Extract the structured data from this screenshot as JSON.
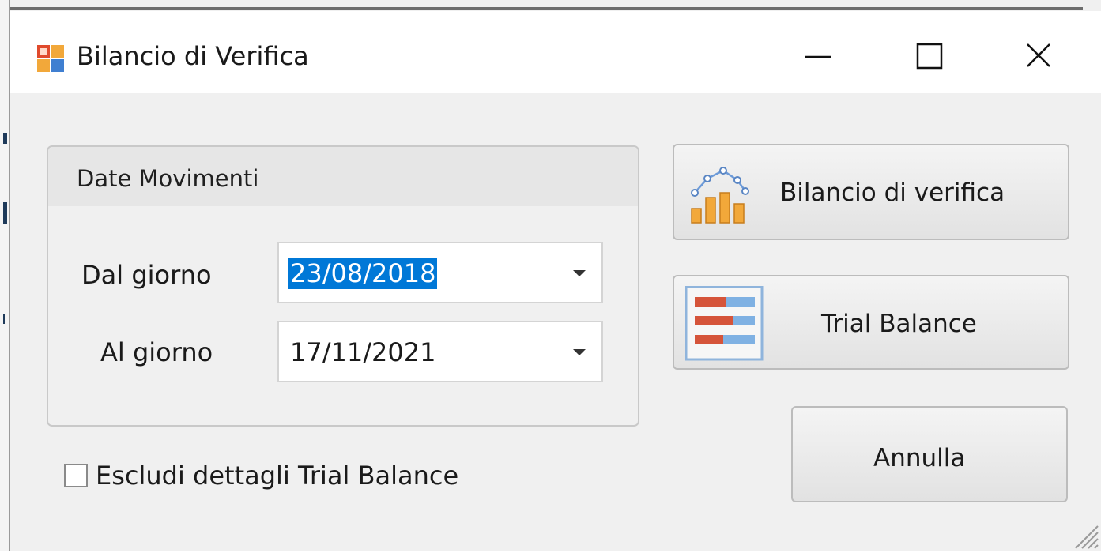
{
  "window": {
    "title": "Bilancio di Verifica",
    "icon": "app-icon",
    "controls": {
      "minimize": "minimize-icon",
      "maximize": "maximize-icon",
      "close": "close-icon"
    }
  },
  "date_group": {
    "title": "Date Movimenti",
    "from_label": "Dal giorno",
    "from_value": "23/08/2018",
    "to_label": "Al giorno",
    "to_value": "17/11/2021"
  },
  "buttons": {
    "verifica_label": "Bilancio di verifica",
    "verifica_icon": "chart-icon",
    "trial_label": "Trial Balance",
    "trial_icon": "table-icon",
    "cancel_label": "Annulla"
  },
  "exclude_details": {
    "label": "Escludi dettagli Trial Balance",
    "checked": false
  },
  "colors": {
    "selection": "#0078d7",
    "chart_bars": "#f2a83a",
    "chart_line": "#6c9ad8",
    "table_red": "#d5543a",
    "table_blue": "#7fb1e3"
  }
}
